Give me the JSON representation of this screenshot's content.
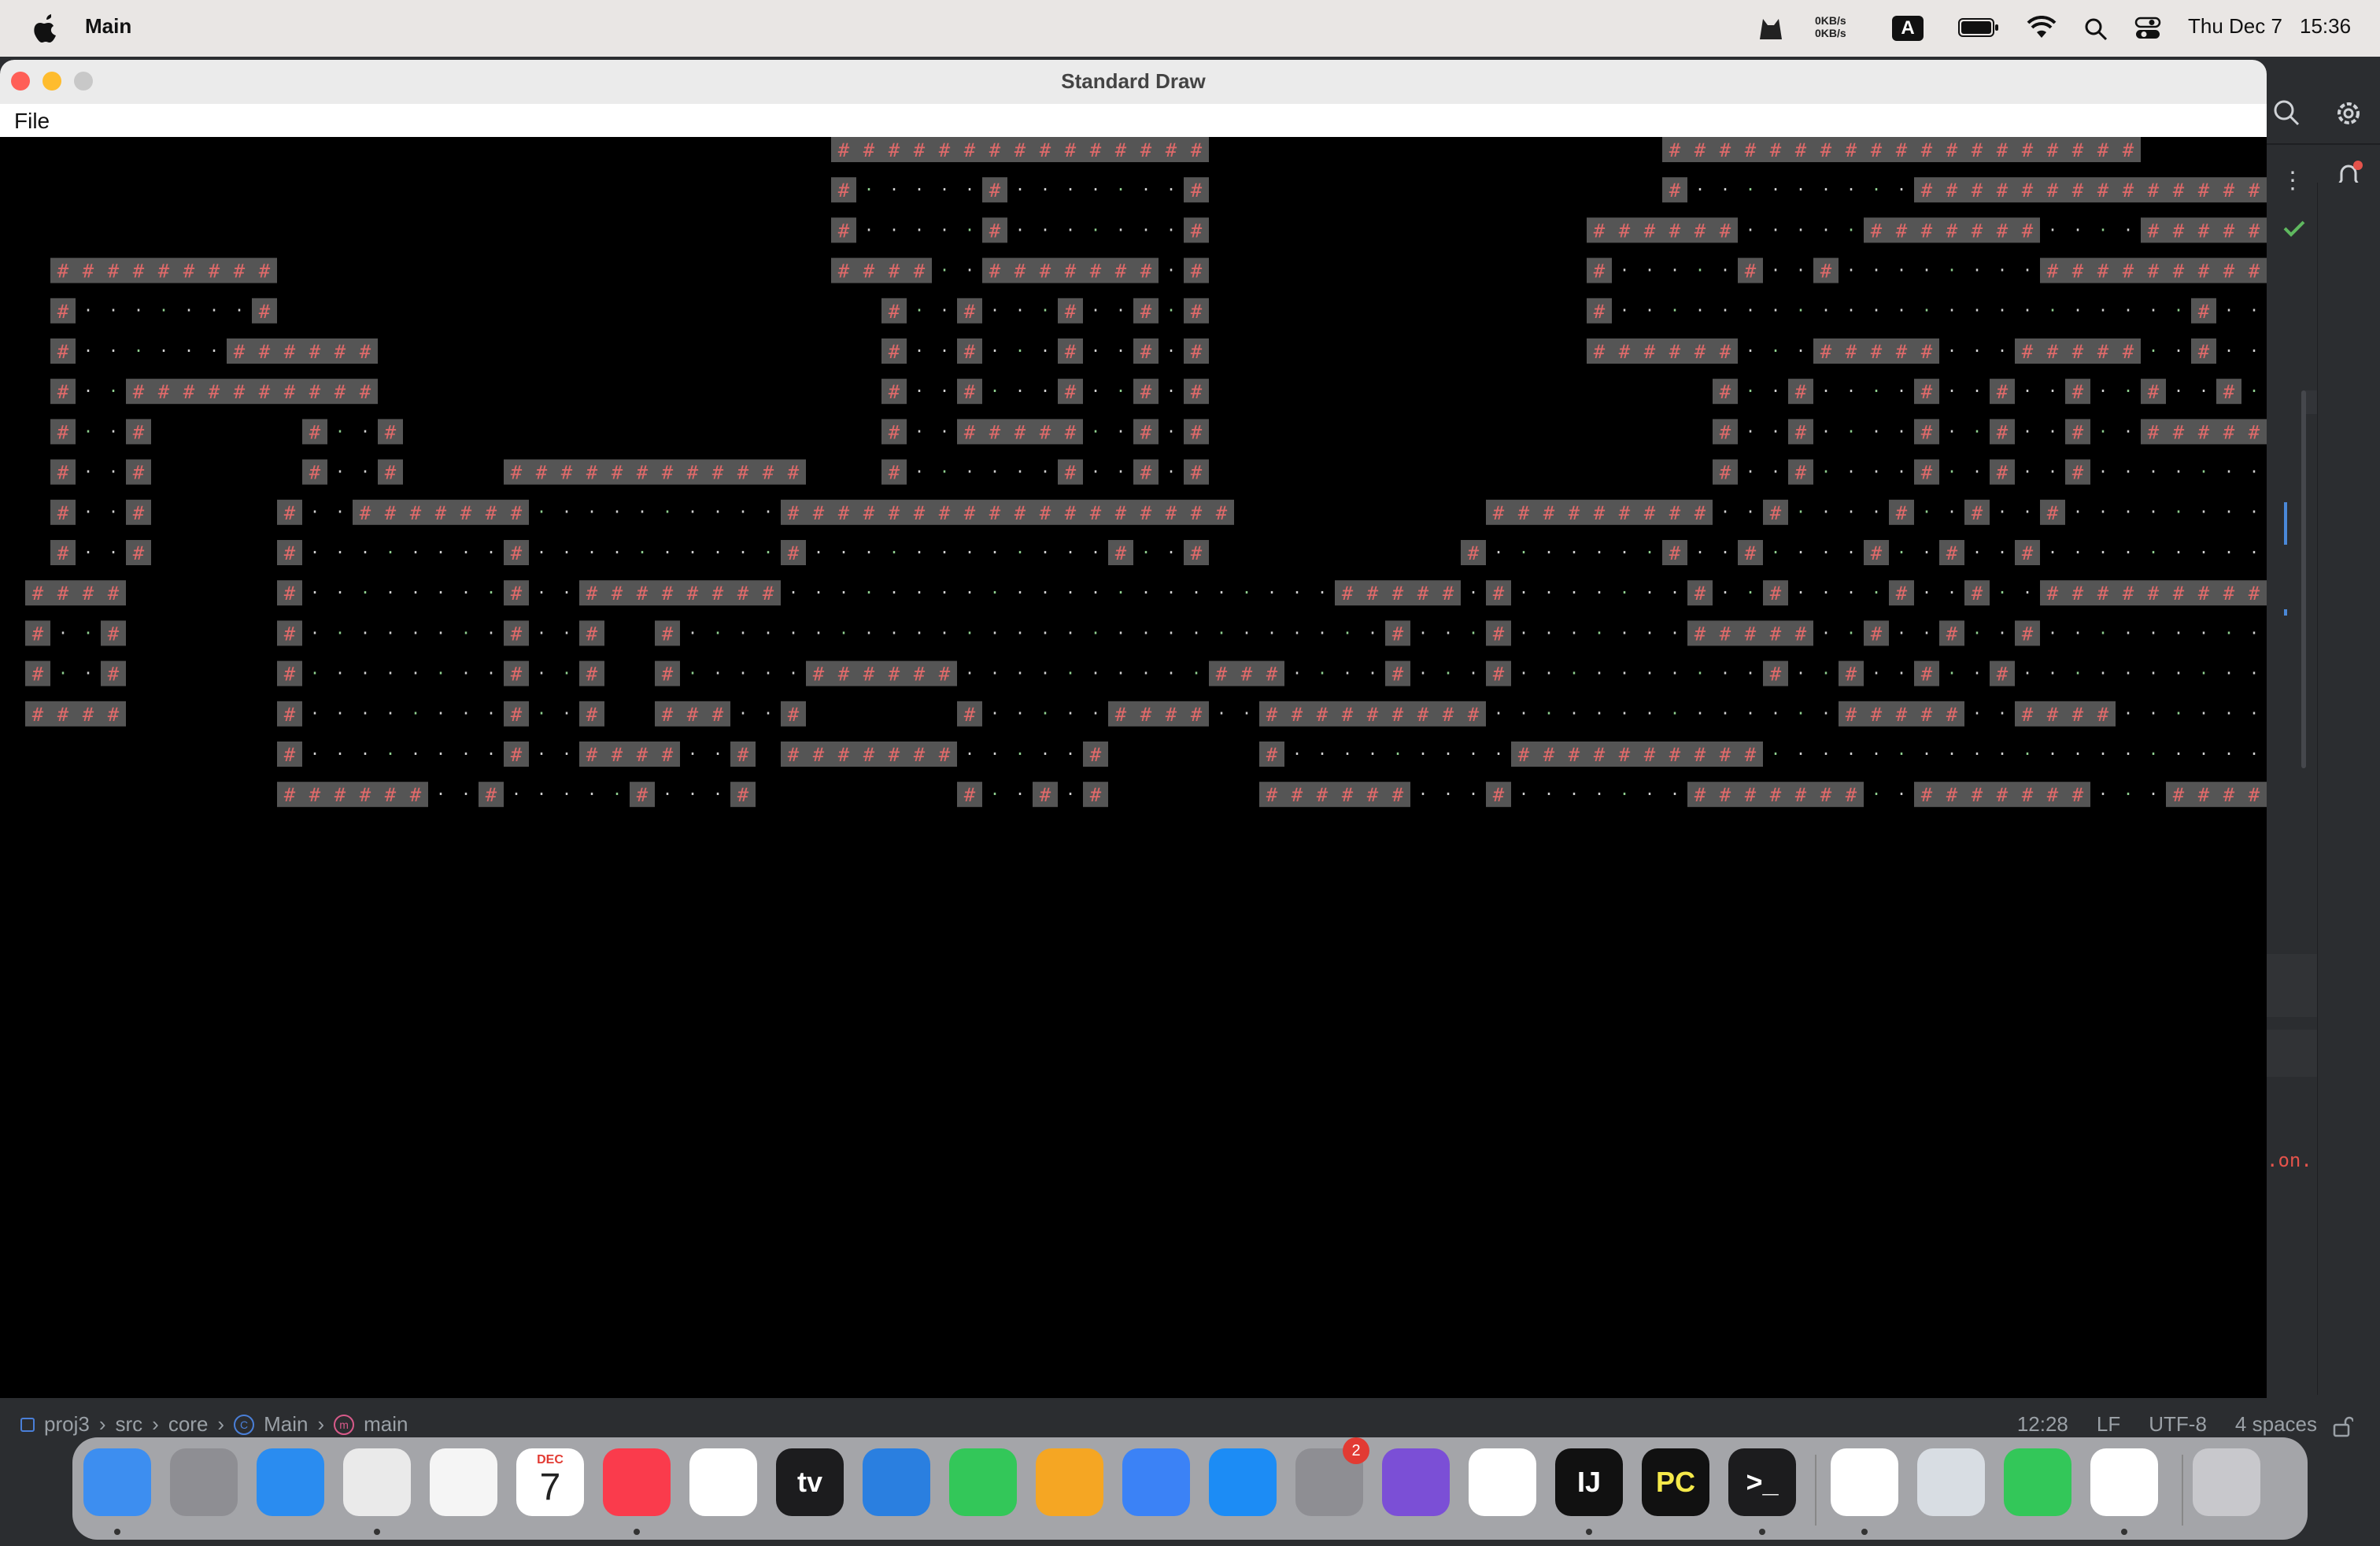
{
  "menubar": {
    "app_name": "Main",
    "net_up": "0KB/s",
    "net_down": "0KB/s",
    "input_source": "A",
    "date": "Thu Dec 7",
    "time": "15:36"
  },
  "window": {
    "title": "Standard Draw",
    "file_menu": "File"
  },
  "canvas": {
    "background": "#000000",
    "wall_char": "#",
    "wall_bg": "#555555",
    "wall_fg": "#e06a6a",
    "floor_char": "·",
    "floor_fg": "#d0d0d0",
    "floor_fg_alt": "#8fcf8f",
    "grid_rows": [
      "                                 ###############                  ###################                     ",
      "                                 #.....#.......#                  #.........#####################      ",
      "                                 #.....#.......#               ######.....#######....#########...#     ",
      "  #########                      ####..#######.#               #.....#..#........############...#     ",
      "  #.......#                        #..#...#..#.#               #.......................#......#..#     ",
      "  #......######                    #..#...#..#.#               ######...#####...#####..#......#..#     ",
      "  #..##########                    #..#...#..#.#                    #..#....#..#..#..#..#......#..#     ",
      "  #..#      #..#                   #..#####..#.#                    #..#....#..#..#..##########..#     ",
      "  #..#      #..#    ############   #......#..#.#                    #..#....#..#..#..........#...#     ",
      "  #..#     #..#######..........##################          #########..#....#..#..#..........#...#     ",
      "  #..#     #........#..........#............#..#          #.......#..#....#..#..#..........#...#     ",
      " ####      #........#..########......................#####.#.......#..#....#..#..############...#     ",
      " #..#      #........#..#  #............................#...#.......#####..#..#..#..........#...#     ",
      " #..#      #........#..#  #.....######..........###....#...#..........#..#..#..#..........#...#     ",
      " ####      #........#..#  ###..#      #.....####..#########..............#####..####......#...#     ",
      "           #........#..####..# #######.....#      #.........##########..........................#     ",
      "           ######..#.....#...#        #..#.#      ######...#.......#######..#######...############    "
    ]
  },
  "ide": {
    "notification_dot": "#e5534b",
    "check_color": "#5fb85f",
    "error_snippet": ".on."
  },
  "statusbar": {
    "crumbs": [
      "proj3",
      "src",
      "core",
      "Main",
      "main"
    ],
    "position": "12:28",
    "line_ending": "LF",
    "encoding": "UTF-8",
    "indent": "4 spaces"
  },
  "dock": {
    "items": [
      {
        "name": "Finder",
        "icon": "finder-icon",
        "color": "#3d8ef0",
        "running": true
      },
      {
        "name": "Launchpad",
        "icon": "launchpad-icon",
        "color": "#8e8e93",
        "running": false
      },
      {
        "name": "Safari",
        "icon": "safari-icon",
        "color": "#2a8cf0",
        "running": false
      },
      {
        "name": "Chrome",
        "icon": "chrome-icon",
        "color": "#eaeaea",
        "running": true
      },
      {
        "name": "Photos",
        "icon": "photos-icon",
        "color": "#f5f5f5",
        "running": false
      },
      {
        "name": "Calendar",
        "icon": "calendar-icon",
        "color": "#ffffff",
        "running": false,
        "month": "DEC",
        "day": "7"
      },
      {
        "name": "Music",
        "icon": "music-icon",
        "color": "#fa3b4c",
        "running": true
      },
      {
        "name": "Reminders",
        "icon": "reminders-icon",
        "color": "#ffffff",
        "running": false
      },
      {
        "name": "TV",
        "icon": "tv-icon",
        "color": "#1c1c1e",
        "running": false,
        "label": "tv"
      },
      {
        "name": "Keynote",
        "icon": "keynote-icon",
        "color": "#2a7fe0",
        "running": false
      },
      {
        "name": "Numbers",
        "icon": "numbers-icon",
        "color": "#33c759",
        "running": false
      },
      {
        "name": "Pages",
        "icon": "pages-icon",
        "color": "#f5a623",
        "running": false
      },
      {
        "name": "Cursor",
        "icon": "cat-icon",
        "color": "#3b82f6",
        "running": false
      },
      {
        "name": "App Store",
        "icon": "appstore-icon",
        "color": "#1c8cf5",
        "running": false
      },
      {
        "name": "System Settings",
        "icon": "settings-icon",
        "color": "#8e8e93",
        "running": false,
        "badge": "2"
      },
      {
        "name": "GitHub Desktop",
        "icon": "github-icon",
        "color": "#7b4fd6",
        "running": false
      },
      {
        "name": "VS Code",
        "icon": "vscode-icon",
        "color": "#ffffff",
        "running": false
      },
      {
        "name": "IntelliJ",
        "icon": "intellij-icon",
        "color": "#111111",
        "running": true,
        "label": "IJ"
      },
      {
        "name": "PyCharm",
        "icon": "pycharm-icon",
        "color": "#111111",
        "running": false,
        "label": "PC"
      },
      {
        "name": "Terminal",
        "icon": "terminal-icon",
        "color": "#1c1c1e",
        "running": true,
        "label": ">_"
      },
      {
        "name": "TextEdit",
        "icon": "textedit-icon",
        "color": "#ffffff",
        "running": true
      },
      {
        "name": "Preview",
        "icon": "preview-icon",
        "color": "#d8dde3",
        "running": false
      },
      {
        "name": "FaceTime",
        "icon": "facetime-icon",
        "color": "#33c759",
        "running": false
      },
      {
        "name": "Java",
        "icon": "java-icon",
        "color": "#ffffff",
        "running": true
      },
      {
        "name": "Trash",
        "icon": "trash-icon",
        "color": "#c8c8cc",
        "running": false
      }
    ]
  }
}
